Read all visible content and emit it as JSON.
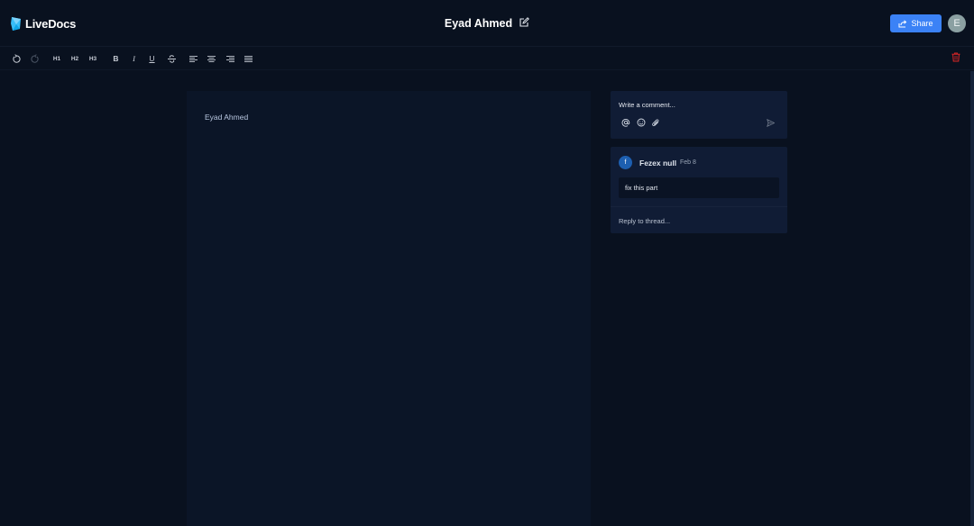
{
  "app": {
    "name": "LiveDocs"
  },
  "document": {
    "title": "Eyad Ahmed",
    "content": "Eyad Ahmed"
  },
  "header": {
    "share_label": "Share",
    "avatar_initial": "E"
  },
  "toolbar": {
    "h1": "H1",
    "h2": "H2",
    "h3": "H3",
    "bold": "B",
    "italic": "I",
    "underline": "U"
  },
  "comments": {
    "composer_placeholder": "Write a comment...",
    "threads": [
      {
        "avatar_initial": "f",
        "author": "Fezex null",
        "date": "Feb 8",
        "body": "fix this part",
        "reply_placeholder": "Reply to thread..."
      }
    ]
  },
  "colors": {
    "background": "#09111f",
    "editor_bg": "#0b1527",
    "panel_bg": "#101c35",
    "accent": "#3b82f6",
    "danger": "#dc2626"
  }
}
